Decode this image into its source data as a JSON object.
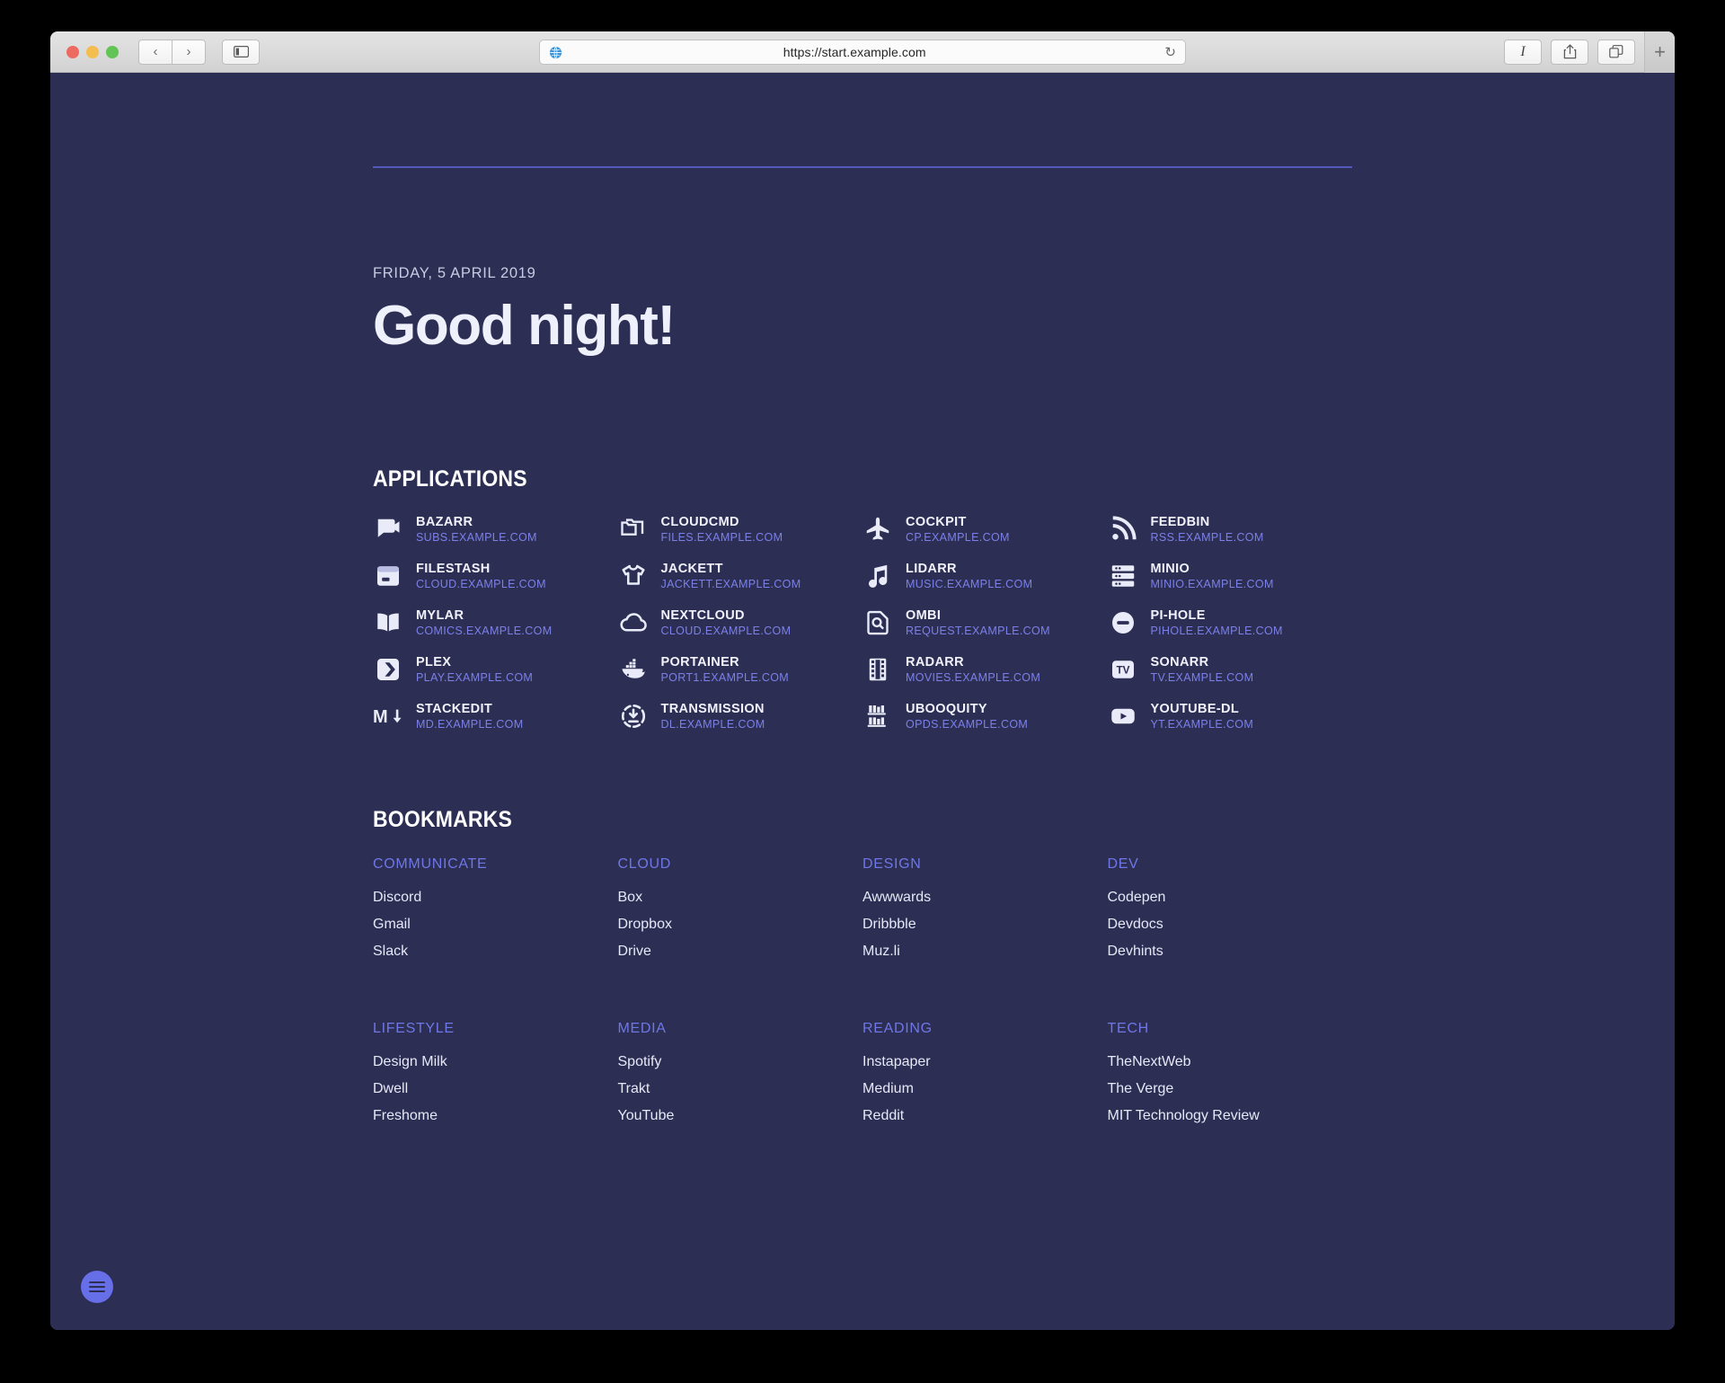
{
  "browser": {
    "url": "https://start.example.com",
    "traffic_lights": [
      "close",
      "minimize",
      "zoom"
    ],
    "back_label": "‹",
    "forward_label": "›",
    "sidebar_label": "sidebar-icon",
    "reload_label": "↻",
    "reader_label": "I",
    "share_label": "share-icon",
    "tabs_label": "tab-overview-icon",
    "new_tab_label": "+"
  },
  "page": {
    "date": "FRIDAY, 5 APRIL 2019",
    "greeting": "Good night!",
    "applications_title": "APPLICATIONS",
    "bookmarks_title": "BOOKMARKS",
    "menu_button_label": "menu"
  },
  "colors": {
    "background": "#2c2e54",
    "accent": "#666ee8",
    "link": "#7b80e8",
    "heading": "#ffffff",
    "rule": "#5a5fd0"
  },
  "applications": [
    {
      "name": "BAZARR",
      "url": "SUBS.EXAMPLE.COM",
      "icon": "video-subtitles-icon"
    },
    {
      "name": "CLOUDCMD",
      "url": "FILES.EXAMPLE.COM",
      "icon": "folders-icon"
    },
    {
      "name": "COCKPIT",
      "url": "CP.EXAMPLE.COM",
      "icon": "airplane-icon"
    },
    {
      "name": "FEEDBIN",
      "url": "RSS.EXAMPLE.COM",
      "icon": "rss-icon"
    },
    {
      "name": "FILESTASH",
      "url": "CLOUD.EXAMPLE.COM",
      "icon": "archive-box-icon"
    },
    {
      "name": "JACKETT",
      "url": "JACKETT.EXAMPLE.COM",
      "icon": "tshirt-icon"
    },
    {
      "name": "LIDARR",
      "url": "MUSIC.EXAMPLE.COM",
      "icon": "music-note-icon"
    },
    {
      "name": "MINIO",
      "url": "MINIO.EXAMPLE.COM",
      "icon": "server-stack-icon"
    },
    {
      "name": "MYLAR",
      "url": "COMICS.EXAMPLE.COM",
      "icon": "open-book-icon"
    },
    {
      "name": "NEXTCLOUD",
      "url": "CLOUD.EXAMPLE.COM",
      "icon": "cloud-icon"
    },
    {
      "name": "OMBI",
      "url": "REQUEST.EXAMPLE.COM",
      "icon": "document-search-icon"
    },
    {
      "name": "PI-HOLE",
      "url": "PIHOLE.EXAMPLE.COM",
      "icon": "block-circle-icon"
    },
    {
      "name": "PLEX",
      "url": "PLAY.EXAMPLE.COM",
      "icon": "plex-chevron-icon"
    },
    {
      "name": "PORTAINER",
      "url": "PORT1.EXAMPLE.COM",
      "icon": "docker-whale-icon"
    },
    {
      "name": "RADARR",
      "url": "MOVIES.EXAMPLE.COM",
      "icon": "film-strip-icon"
    },
    {
      "name": "SONARR",
      "url": "TV.EXAMPLE.COM",
      "icon": "tv-badge-icon"
    },
    {
      "name": "STACKEDIT",
      "url": "MD.EXAMPLE.COM",
      "icon": "markdown-icon"
    },
    {
      "name": "TRANSMISSION",
      "url": "DL.EXAMPLE.COM",
      "icon": "download-circle-icon"
    },
    {
      "name": "UBOOQUITY",
      "url": "OPDS.EXAMPLE.COM",
      "icon": "bookshelf-icon"
    },
    {
      "name": "YOUTUBE-DL",
      "url": "YT.EXAMPLE.COM",
      "icon": "youtube-play-icon"
    }
  ],
  "bookmarks": [
    {
      "category": "COMMUNICATE",
      "links": [
        "Discord",
        "Gmail",
        "Slack"
      ]
    },
    {
      "category": "CLOUD",
      "links": [
        "Box",
        "Dropbox",
        "Drive"
      ]
    },
    {
      "category": "DESIGN",
      "links": [
        "Awwwards",
        "Dribbble",
        "Muz.li"
      ]
    },
    {
      "category": "DEV",
      "links": [
        "Codepen",
        "Devdocs",
        "Devhints"
      ]
    },
    {
      "category": "LIFESTYLE",
      "links": [
        "Design Milk",
        "Dwell",
        "Freshome"
      ]
    },
    {
      "category": "MEDIA",
      "links": [
        "Spotify",
        "Trakt",
        "YouTube"
      ]
    },
    {
      "category": "READING",
      "links": [
        "Instapaper",
        "Medium",
        "Reddit"
      ]
    },
    {
      "category": "TECH",
      "links": [
        "TheNextWeb",
        "The Verge",
        "MIT Technology Review"
      ]
    }
  ]
}
